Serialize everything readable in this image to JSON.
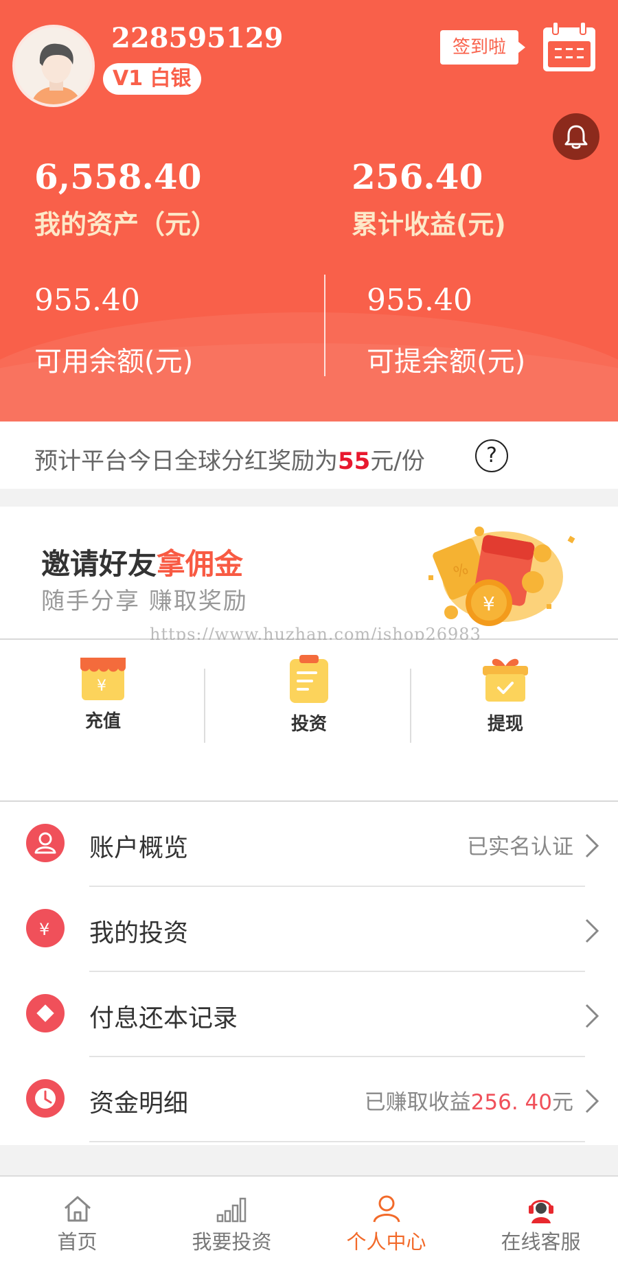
{
  "profile": {
    "user_id": "228595129",
    "level": "V1 白银",
    "checkin_label": "签到啦"
  },
  "assets": {
    "total_value": "6,558.40",
    "total_label": "我的资产（元）",
    "earnings_value": "256.40",
    "earnings_label": "累计收益(元)",
    "available_value": "955.40",
    "available_label": "可用余额(元)",
    "withdrawable_value": "955.40",
    "withdrawable_label": "可提余额(元)"
  },
  "notice": {
    "prefix": "预计平台今日全球分红奖励为",
    "amount": "55",
    "suffix": "元/份",
    "help_glyph": "?"
  },
  "invite": {
    "title_plain": "邀请好友",
    "title_highlight": "拿佣金",
    "subtitle": "随手分享 赚取奖励"
  },
  "watermark": "https://www.huzhan.com/ishop26983",
  "quick_actions": [
    {
      "label": "充值",
      "icon": "shop-icon"
    },
    {
      "label": "投资",
      "icon": "clipboard-icon"
    },
    {
      "label": "提现",
      "icon": "gift-icon"
    }
  ],
  "menu": [
    {
      "label": "账户概览",
      "right": "已实名认证",
      "icon": "user-icon"
    },
    {
      "label": "我的投资",
      "right": "",
      "icon": "yen-icon"
    },
    {
      "label": "付息还本记录",
      "right": "",
      "icon": "diamond-icon"
    },
    {
      "label": "资金明细",
      "right_prefix": "已赚取收益",
      "right_amount": "256. 40",
      "right_suffix": "元",
      "icon": "clock-icon"
    }
  ],
  "tabs": [
    {
      "label": "首页",
      "icon": "home-icon",
      "active": false
    },
    {
      "label": "我要投资",
      "icon": "bar-chart-icon",
      "active": false
    },
    {
      "label": "个人中心",
      "icon": "person-icon",
      "active": true
    },
    {
      "label": "在线客服",
      "icon": "headset-icon",
      "active": false
    }
  ],
  "colors": {
    "brand": "#f9604a",
    "accent_red": "#e8182e",
    "menu_icon": "#f0505a",
    "tab_active": "#f26a2a"
  }
}
